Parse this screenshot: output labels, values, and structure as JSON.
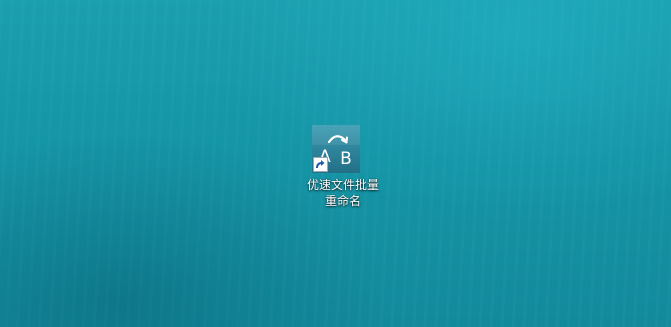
{
  "desktop": {
    "shortcut": {
      "icon_name": "rename-a-to-b-icon",
      "overlay_icon": "shortcut-arrow-icon",
      "label_line1": "优速文件批量",
      "label_line2": "重命名"
    }
  },
  "colors": {
    "background": "#1595a6",
    "icon_tile": "#2f8fa5",
    "label_text": "#ffffff"
  }
}
